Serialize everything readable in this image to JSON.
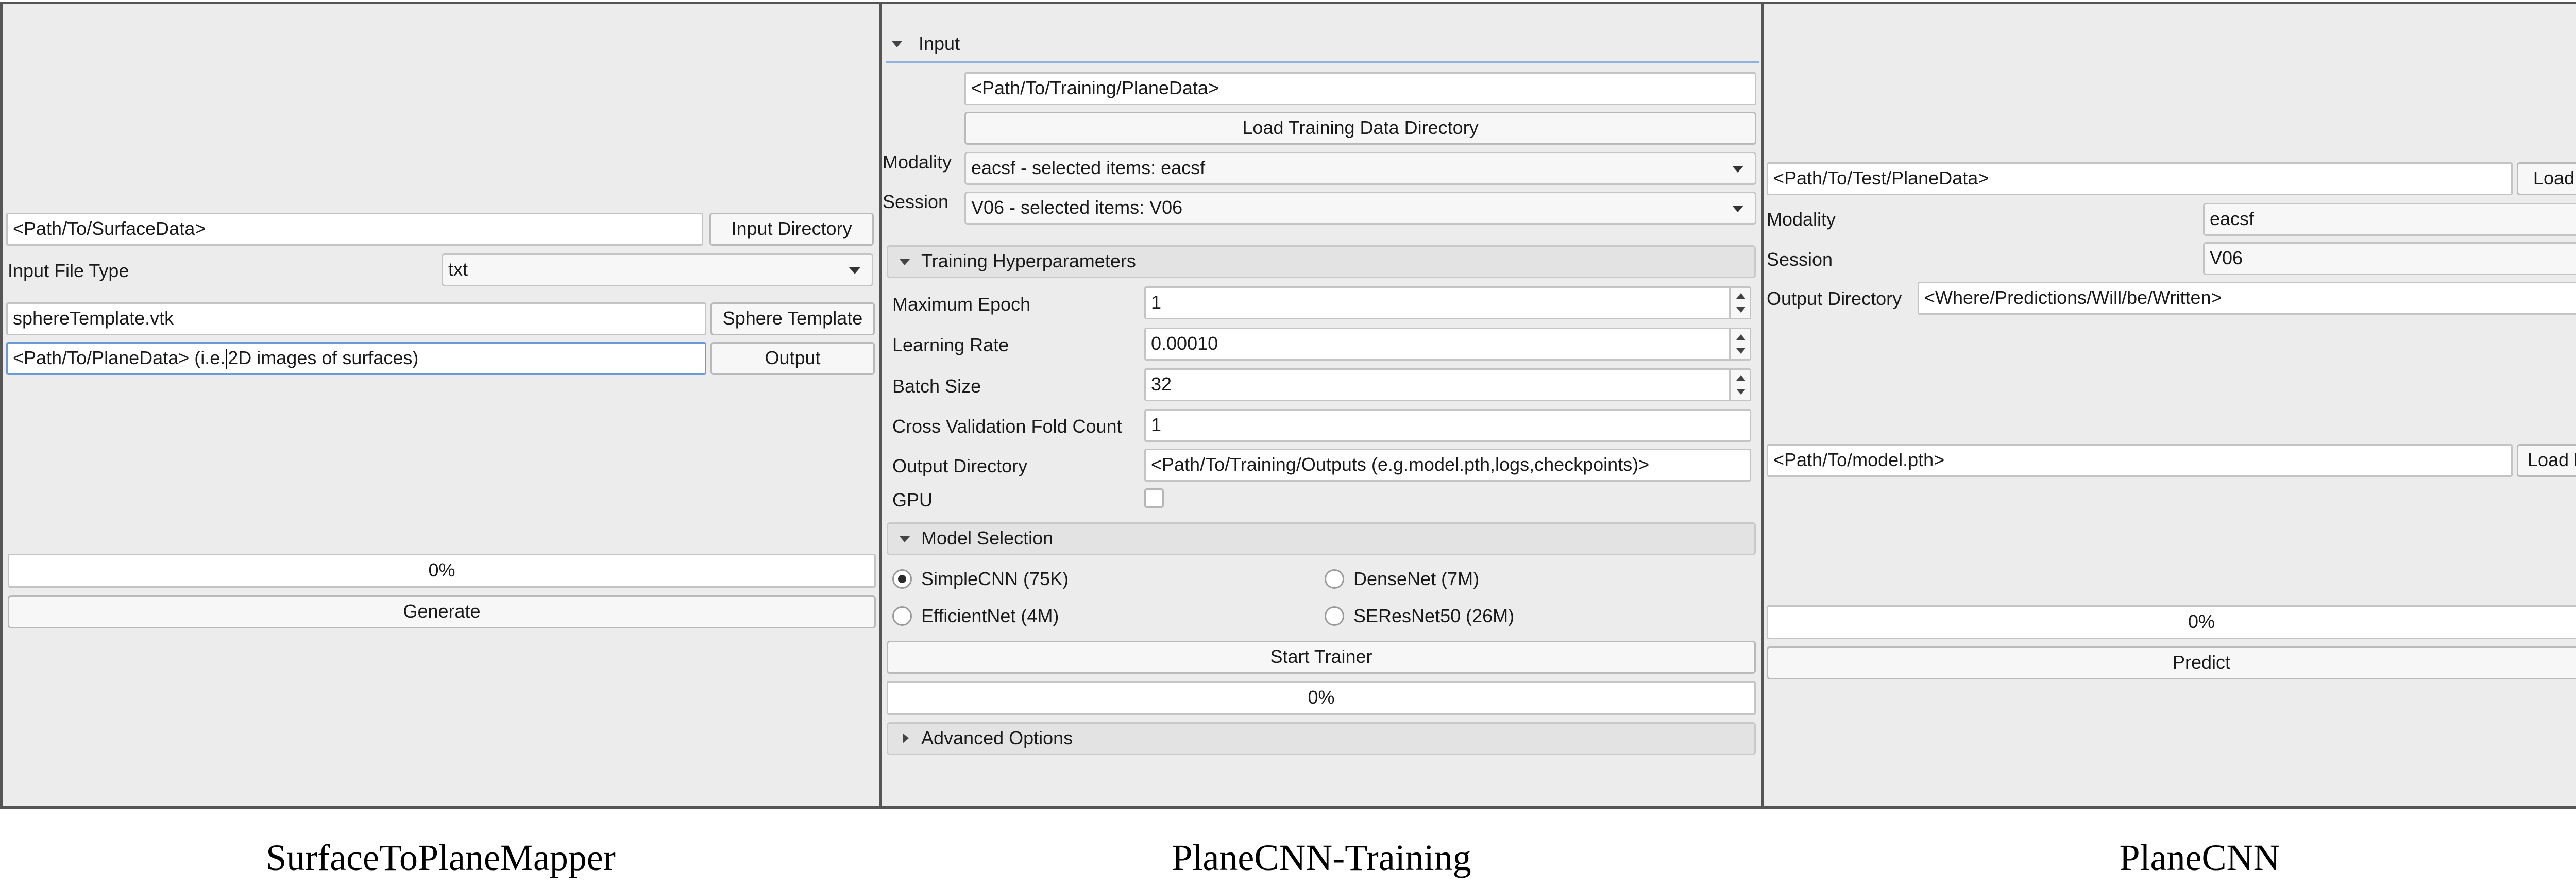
{
  "surface_mapper": {
    "input_path": "<Path/To/SurfaceData>",
    "input_directory_button": "Input Directory",
    "input_file_type_label": "Input File Type",
    "input_file_type_value": "txt",
    "sphere_path": "sphereTemplate.vtk",
    "sphere_template_button": "Sphere Template",
    "output_path_before_caret": "<Path/To/PlaneData> (i.e.",
    "output_path_after_caret": "2D images of surfaces)",
    "output_button": "Output",
    "progress_text": "0%",
    "progress_value": 0,
    "generate_button": "Generate",
    "caption": "SurfaceToPlaneMapper"
  },
  "training": {
    "input_section": "Input",
    "training_path": "<Path/To/Training/PlaneData>",
    "load_training_button": "Load Training Data Directory",
    "modality_label": "Modality",
    "modality_value": "eacsf - selected items: eacsf",
    "session_label": "Session",
    "session_value": "V06 - selected items: V06",
    "hyper_section": "Training Hyperparameters",
    "max_epoch_label": "Maximum Epoch",
    "max_epoch_value": "1",
    "learning_rate_label": "Learning Rate",
    "learning_rate_value": "0.00010",
    "batch_size_label": "Batch Size",
    "batch_size_value": "32",
    "cv_label": "Cross Validation Fold Count",
    "cv_value": "1",
    "output_dir_label": "Output Directory",
    "output_dir_value": "<Path/To/Training/Outputs (e.g.model.pth,logs,checkpoints)>",
    "gpu_label": "GPU",
    "gpu_checked": false,
    "model_section": "Model Selection",
    "models": [
      {
        "label": "SimpleCNN (75K)",
        "selected": true
      },
      {
        "label": "DenseNet (7M)",
        "selected": false
      },
      {
        "label": "EfficientNet (4M)",
        "selected": false
      },
      {
        "label": "SEResNet50 (26M)",
        "selected": false
      }
    ],
    "start_trainer_button": "Start Trainer",
    "progress_text": "0%",
    "progress_value": 0,
    "advanced_section": "Advanced Options",
    "caption": "PlaneCNN-Training"
  },
  "planecnn": {
    "test_path": "<Path/To/Test/PlaneData>",
    "load_data_button": "Load Data",
    "modality_label": "Modality",
    "modality_value": "eacsf",
    "session_label": "Session",
    "session_value": "V06",
    "output_dir_label": "Output Directory",
    "output_dir_value": "<Where/Predictions/Will/be/Written>",
    "model_path": "<Path/To/model.pth>",
    "load_model_button": "Load Model",
    "progress_text": "0%",
    "progress_value": 0,
    "predict_button": "Predict",
    "caption": "PlaneCNN"
  },
  "colors": {
    "panel_bg": "#ececec",
    "panel_border": "#555555",
    "focus_border": "#6b9bd7"
  }
}
